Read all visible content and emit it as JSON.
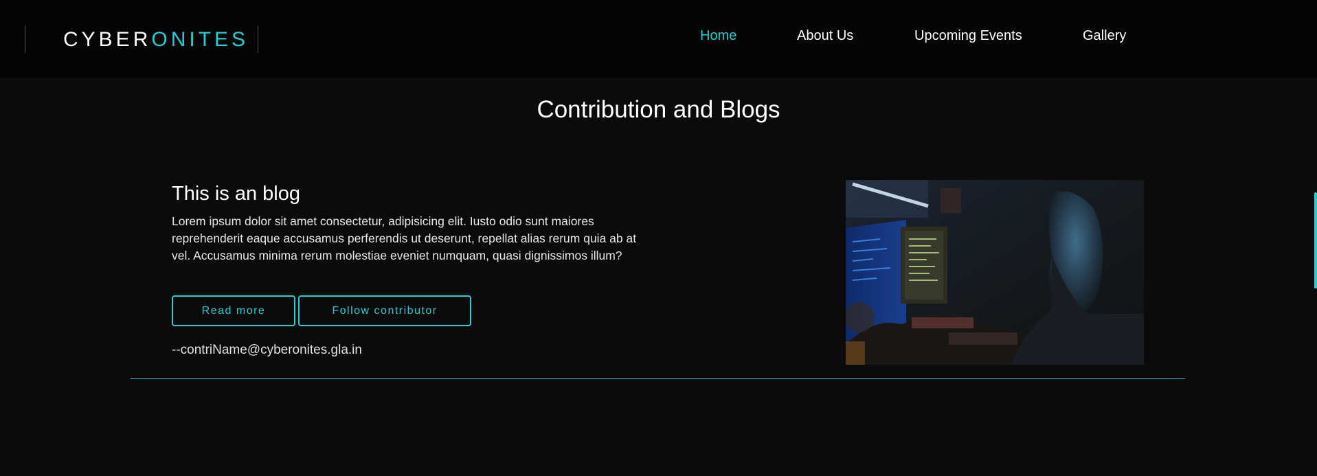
{
  "brand": {
    "part1": "CYBER",
    "part2": "ONITES",
    "accent_color": "#1ecfd6"
  },
  "nav": {
    "items": [
      {
        "label": "Home",
        "active": true
      },
      {
        "label": "About Us",
        "active": false
      },
      {
        "label": "Upcoming Events",
        "active": false
      },
      {
        "label": "Gallery",
        "active": false
      }
    ]
  },
  "main": {
    "section_title": "Contribution and Blogs",
    "blog": {
      "title": "This is an blog",
      "text": "Lorem ipsum dolor sit amet consectetur, adipisicing elit. Iusto odio sunt maiores reprehenderit eaque accusamus perferendis ut deserunt, repellat alias rerum quia ab at vel. Accusamus minima rerum molestiae eveniet numquam, quasi dignissimos illum?",
      "read_more_label": "Read more",
      "follow_label": "Follow contributor",
      "contributor": "--contriName@cyberonites.gla.in",
      "image_icon": "photo-of-hacker-at-computer"
    }
  }
}
